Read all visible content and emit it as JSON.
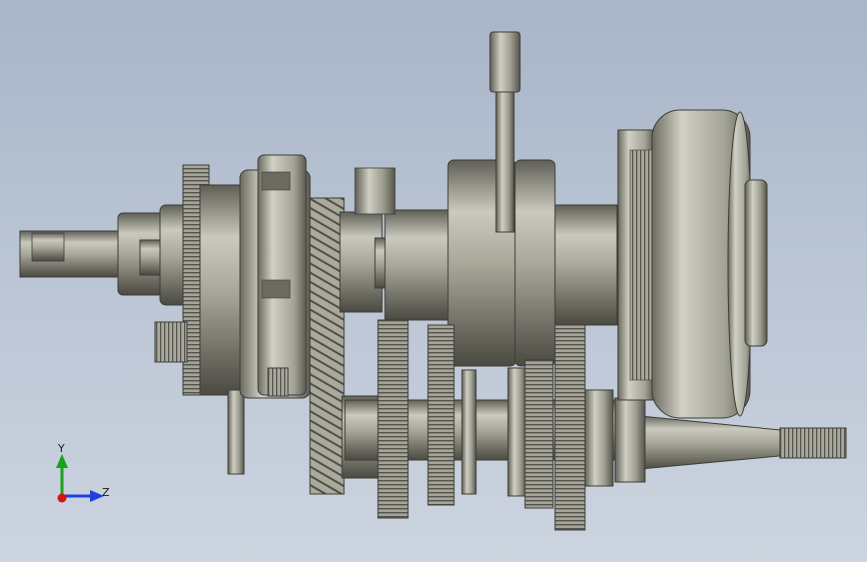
{
  "viewport": {
    "background_top": "#a9b5c8",
    "background_bottom": "#ccd4df"
  },
  "triad": {
    "y_label": "Y",
    "z_label": "Z",
    "y_color": "#1aa31a",
    "z_color": "#1f3fe0",
    "x_color": "#d21414"
  },
  "model": {
    "kind": "transmission-gearbox-assembly",
    "material_color": "#9a9a8e"
  }
}
